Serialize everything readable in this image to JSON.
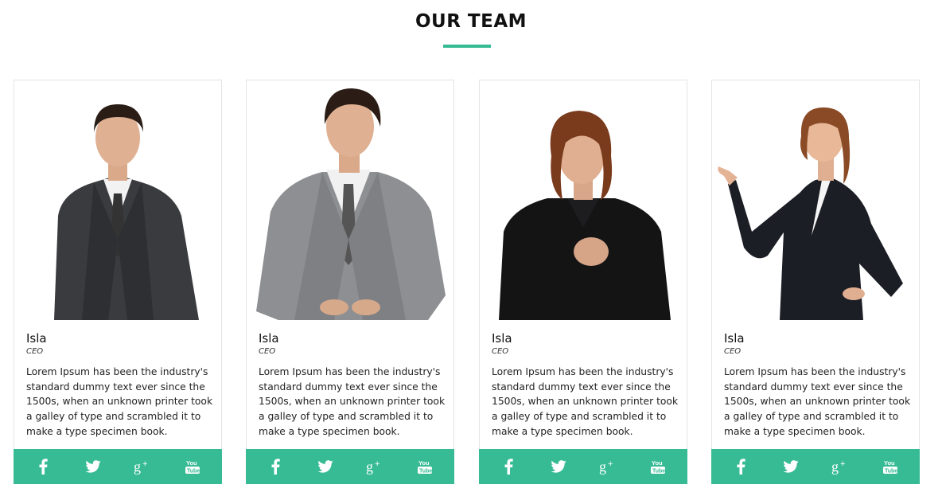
{
  "section": {
    "title": "OUR TEAM"
  },
  "colors": {
    "accent": "#36bb94"
  },
  "team": [
    {
      "name": "Isla",
      "role": "CEO",
      "bio": "Lorem Ipsum has been the industry's standard dummy text ever since the 1500s, when an unknown printer took a galley of type and scrambled it to make a type specimen book.",
      "photo": "man-dark-suit"
    },
    {
      "name": "Isla",
      "role": "CEO",
      "bio": "Lorem Ipsum has been the industry's standard dummy text ever since the 1500s, when an unknown printer took a galley of type and scrambled it to make a type specimen book.",
      "photo": "man-grey-suit"
    },
    {
      "name": "Isla",
      "role": "CEO",
      "bio": "Lorem Ipsum has been the industry's standard dummy text ever since the 1500s, when an unknown printer took a galley of type and scrambled it to make a type specimen book.",
      "photo": "woman-black-shirt"
    },
    {
      "name": "Isla",
      "role": "CEO",
      "bio": "Lorem Ipsum has been the industry's standard dummy text ever since the 1500s, when an unknown printer took a galley of type and scrambled it to make a type specimen book.",
      "photo": "woman-pointing"
    }
  ],
  "social_icons": [
    "facebook-icon",
    "twitter-icon",
    "google-plus-icon",
    "youtube-icon"
  ]
}
